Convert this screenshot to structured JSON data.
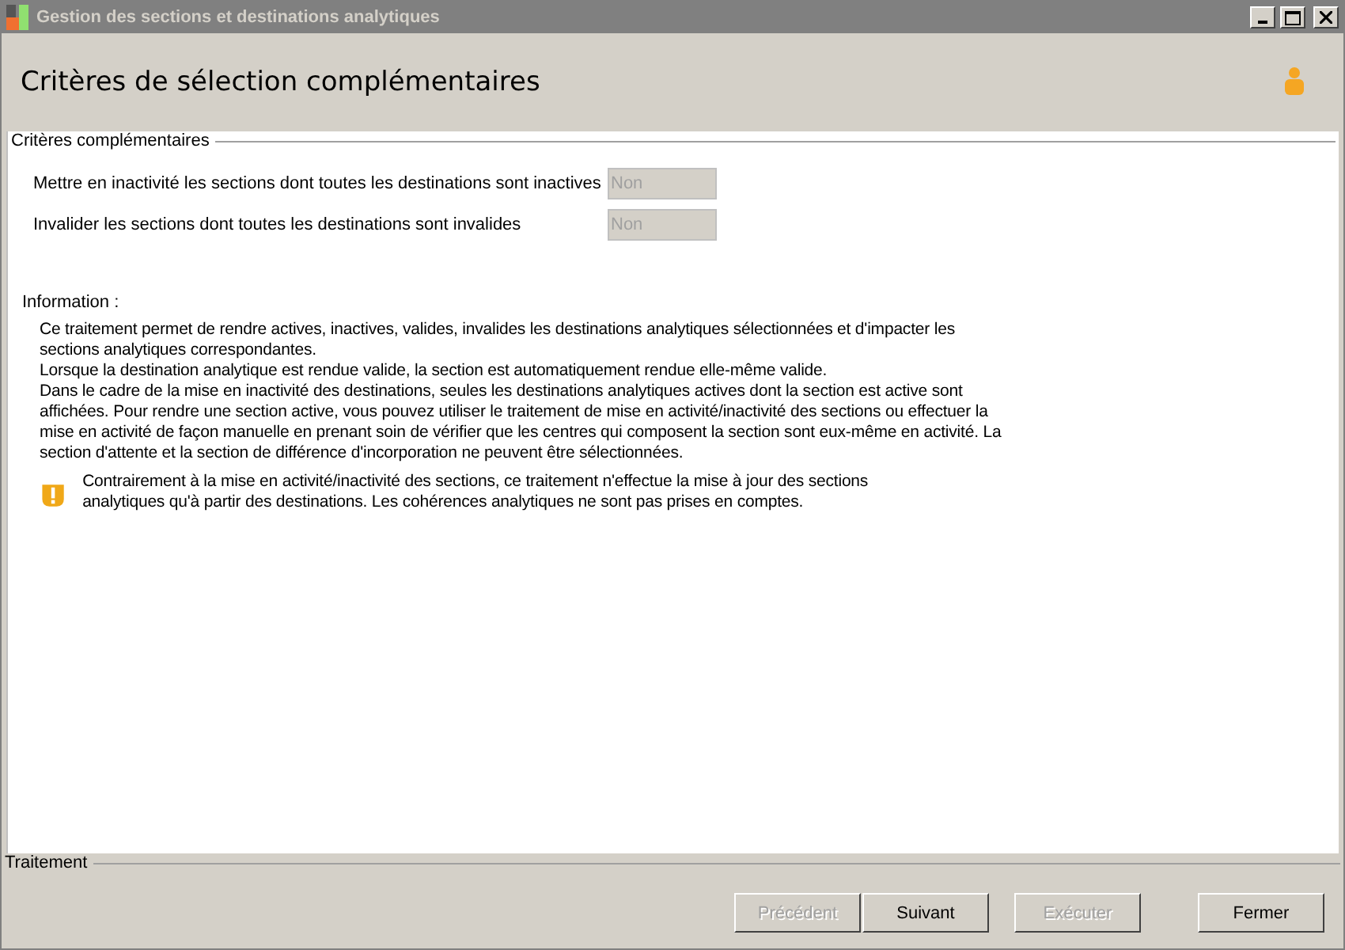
{
  "window": {
    "title": "Gestion des sections et destinations analytiques"
  },
  "header": {
    "title": "Critères de sélection complémentaires"
  },
  "criteria": {
    "legend": "Critères complémentaires",
    "rows": [
      {
        "label": "Mettre en inactivité les sections dont toutes les destinations sont inactives",
        "value": "Non",
        "disabled": true
      },
      {
        "label": "Invalider les sections dont toutes les destinations sont invalides",
        "value": "Non",
        "disabled": true
      }
    ]
  },
  "information": {
    "label": "Information :",
    "paragraphs": [
      "Ce traitement permet de rendre actives, inactives, valides, invalides les destinations analytiques sélectionnées et d'impacter les sections analytiques correspondantes.",
      "Lorsque la destination analytique est rendue valide, la section est automatiquement rendue elle-même valide.",
      "Dans le cadre de la mise en inactivité des destinations, seules les destinations analytiques actives dont la section est active sont affichées. Pour rendre une section active, vous pouvez utiliser le traitement de mise en activité/inactivité des sections ou effectuer la mise en activité de façon manuelle en prenant soin de vérifier que les centres qui composent la section sont eux-même en activité. La section d'attente et la section de différence d'incorporation ne peuvent être sélectionnées."
    ],
    "warning": "Contrairement à la mise en activité/inactivité des sections, ce traitement n'effectue la mise à jour des sections analytiques qu'à partir des destinations. Les cohérences analytiques ne sont pas prises en comptes."
  },
  "footer": {
    "legend": "Traitement",
    "buttons": [
      {
        "label": "Précédent",
        "disabled": true
      },
      {
        "label": "Suivant",
        "disabled": false
      },
      {
        "label": "Exécuter",
        "disabled": true
      },
      {
        "label": "Fermer",
        "disabled": false
      }
    ]
  }
}
